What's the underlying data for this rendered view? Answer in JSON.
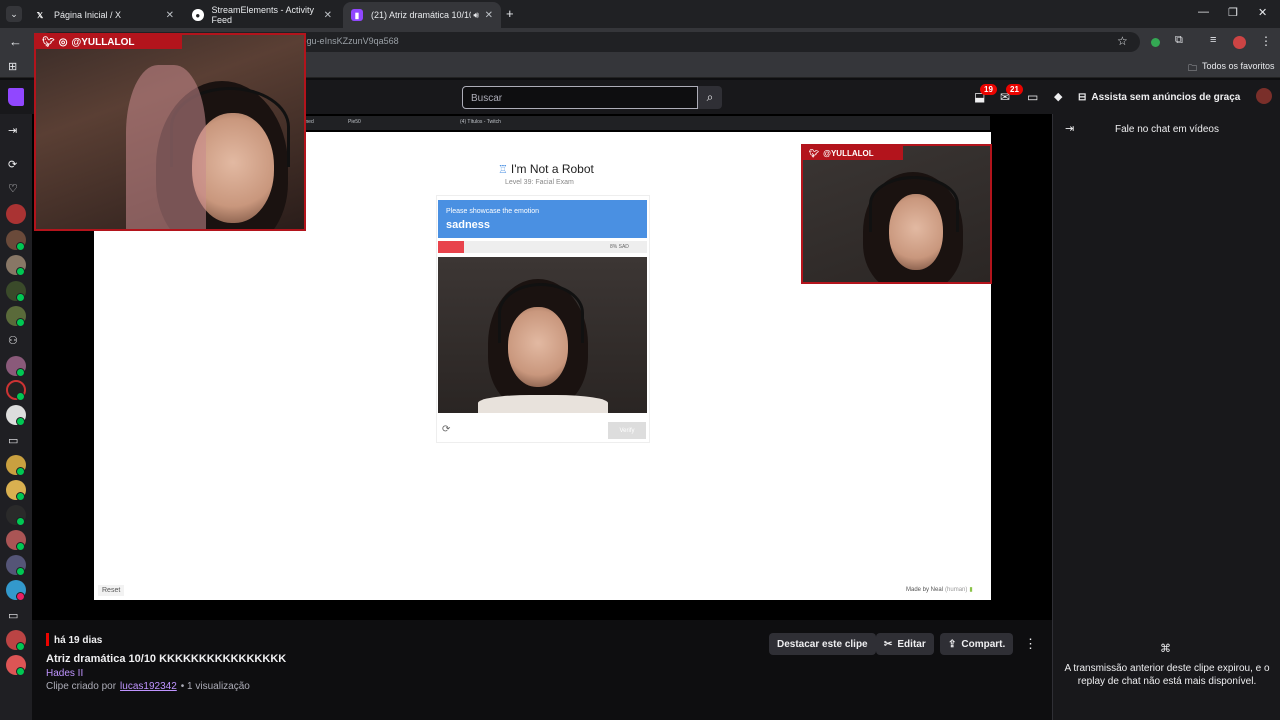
{
  "browser": {
    "tabs": [
      {
        "label": "Página Inicial / X",
        "icon": "x-logo-icon"
      },
      {
        "label": "StreamElements - Activity Feed",
        "icon": "streamelements-icon"
      },
      {
        "label": "(21) Atriz dramática 10/10 I",
        "icon": "twitch-icon"
      }
    ],
    "url": "/GlutenFreeSweetZebraMikeHogu-eInsKZzunV9qa568",
    "bookmarks_label": "Todos os favoritos"
  },
  "twitch": {
    "search_placeholder": "Buscar",
    "notif_count_a": "19",
    "notif_count_b": "21",
    "ad_free_label": "Assista sem anúncios de graça"
  },
  "stream": {
    "webcam_tag": "@YULLALOL",
    "inner_tabs": [
      "med",
      "Pie50",
      "(4) Títulos - Twitch"
    ],
    "captcha": {
      "title": "I'm Not a Robot",
      "subtitle": "Level 39: Facial Exam",
      "instruction": "Please showcase the emotion",
      "emotion": "sadness",
      "progress_label": "8% SAD",
      "progress": 0.12,
      "verify_label": "Verify",
      "reset_label": "Reset",
      "credit": "Made by Neal",
      "credit_sub": "(human)"
    }
  },
  "clip": {
    "age": "há 19 dias",
    "title": "Atriz dramática 10/10 KKKKKKKKKKKKKKKK",
    "game": "Hades II",
    "created_prefix": "Clipe criado por",
    "creator": "lucas192342",
    "views": "• 1 visualização",
    "actions": {
      "feature": "Destacar este clipe",
      "edit": "Editar",
      "share": "Compart."
    }
  },
  "chat": {
    "header": "Fale no chat em vídeos",
    "expired_message": "A transmissão anterior deste clipe expirou, e o replay de chat não está mais disponível."
  },
  "colors": {
    "twitch_purple": "#9147ff",
    "cam_border": "#b3141c",
    "captcha_blue": "#4a90e2",
    "progress_red": "#e8434c"
  }
}
